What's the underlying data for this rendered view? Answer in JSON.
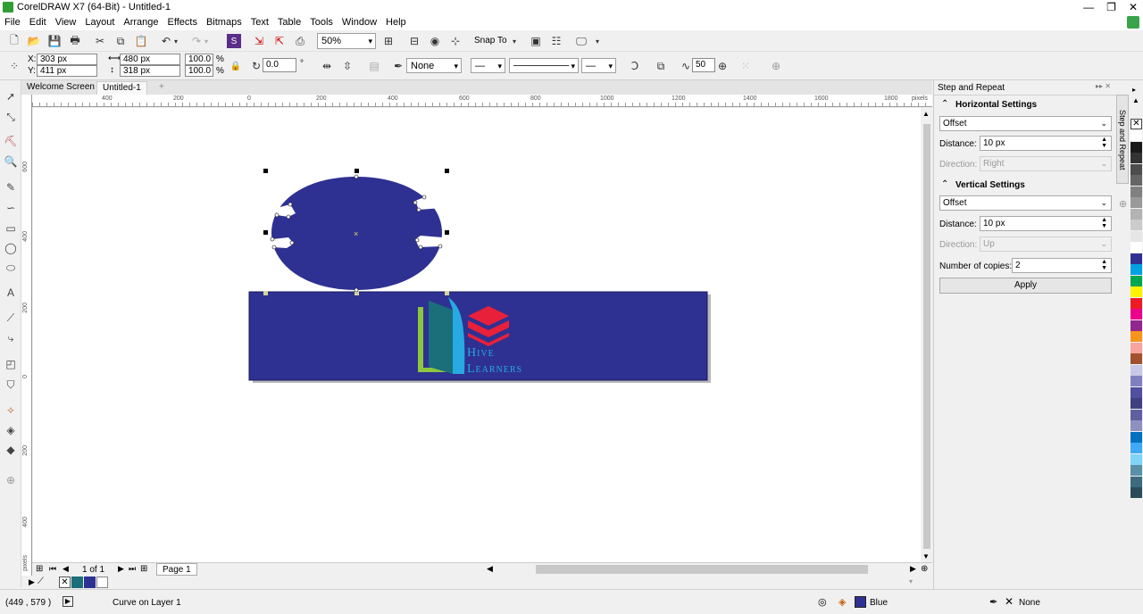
{
  "window": {
    "title": "CorelDRAW X7 (64-Bit) - Untitled-1",
    "min": "—",
    "restore": "❐",
    "close": "✕"
  },
  "menu": [
    "File",
    "Edit",
    "View",
    "Layout",
    "Arrange",
    "Effects",
    "Bitmaps",
    "Text",
    "Table",
    "Tools",
    "Window",
    "Help"
  ],
  "toolbar": {
    "zoom": "50%",
    "snap_to": "Snap To"
  },
  "propbar": {
    "x_label": "X:",
    "x": "303 px",
    "y_label": "Y:",
    "y": "411 px",
    "w": "480 px",
    "h": "318 px",
    "sx": "100.0",
    "sy": "100.0",
    "pct": "%",
    "angle": "0.0",
    "deg": "°",
    "outline_fill": "None",
    "smooth": "50"
  },
  "tabs": {
    "welcome": "Welcome Screen",
    "doc": "Untitled-1",
    "add": "+"
  },
  "ruler": {
    "h_ticks": [
      "400",
      "200",
      "0",
      "200",
      "400",
      "600",
      "800",
      "1000",
      "1200",
      "1400",
      "1600",
      "1800"
    ],
    "unit": "pixels",
    "v_ticks": [
      "600",
      "400",
      "200",
      "0",
      "200",
      "400"
    ]
  },
  "logo": {
    "line1": "Hive",
    "line2": "Learners"
  },
  "pagenav": {
    "count": "1 of 1",
    "page": "Page 1"
  },
  "status": {
    "coords": "(449 , 579 )",
    "object": "Curve on Layer 1",
    "fill_name": "Blue",
    "outline_name": "None"
  },
  "docker": {
    "title": "Step and Repeat",
    "tab_label": "Step and Repeat",
    "horizontal_title": "Horizontal Settings",
    "h_mode": "Offset",
    "h_distance_label": "Distance:",
    "h_distance": "10 px",
    "h_direction_label": "Direction:",
    "h_direction": "Right",
    "vertical_title": "Vertical Settings",
    "v_mode": "Offset",
    "v_distance_label": "Distance:",
    "v_distance": "10 px",
    "v_direction_label": "Direction:",
    "v_direction": "Up",
    "copies_label": "Number of copies:",
    "copies": "2",
    "apply": "Apply"
  },
  "colors": {
    "shape_fill": "#2e3192",
    "logo_red": "#e8203a",
    "logo_green": "#8dc63f",
    "logo_teal": "#1a6f7a",
    "logo_blue": "#27a9e1"
  },
  "palette": [
    "#ffffff",
    "#1a1a1a",
    "#333333",
    "#4d4d4d",
    "#666666",
    "#808080",
    "#999999",
    "#b3b3b3",
    "#cccccc",
    "#e6e6e6",
    "#ffffff",
    "#2e3192",
    "#00a0e3",
    "#00a651",
    "#fff200",
    "#ed1c24",
    "#ec008c",
    "#92278f",
    "#f7941d",
    "#f9a39f",
    "#a0522d",
    "#c8c8e8",
    "#8080c0",
    "#5050a0",
    "#404080",
    "#6060a0",
    "#9090c0",
    "#0070c0",
    "#3fa9f5",
    "#7fd3f7",
    "#5a8fa8",
    "#3d6c80",
    "#2a4c5a"
  ]
}
